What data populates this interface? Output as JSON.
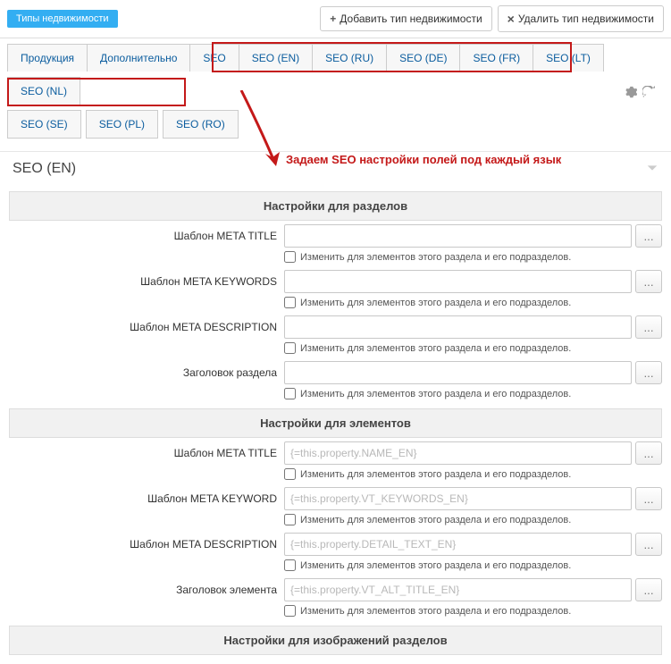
{
  "topbar": {
    "tag": "Типы недвижимости",
    "add_btn": "Добавить тип недвижимости",
    "del_btn": "Удалить тип недвижимости"
  },
  "tabs_row1": [
    "Продукция",
    "Дополнительно",
    "SEO",
    "SEO (EN)",
    "SEO (RU)",
    "SEO (DE)",
    "SEO (FR)",
    "SEO (LT)",
    "SEO (NL)"
  ],
  "tabs_row2": [
    "SEO (SE)",
    "SEO (PL)",
    "SEO (RO)"
  ],
  "section_title": "SEO (EN)",
  "annotation": "Задаем SEO настройки полей под каждый язык",
  "group1_title": "Настройки для разделов",
  "group1_fields": [
    {
      "label": "Шаблон META TITLE",
      "placeholder": "",
      "checkbox": "Изменить для элементов этого раздела и его подразделов."
    },
    {
      "label": "Шаблон META KEYWORDS",
      "placeholder": "",
      "checkbox": "Изменить для элементов этого раздела и его подразделов."
    },
    {
      "label": "Шаблон META DESCRIPTION",
      "placeholder": "",
      "checkbox": "Изменить для элементов этого раздела и его подразделов."
    },
    {
      "label": "Заголовок раздела",
      "placeholder": "",
      "checkbox": "Изменить для элементов этого раздела и его подразделов."
    }
  ],
  "group2_title": "Настройки для элементов",
  "group2_fields": [
    {
      "label": "Шаблон META TITLE",
      "placeholder": "{=this.property.NAME_EN}",
      "checkbox": "Изменить для элементов этого раздела и его подразделов."
    },
    {
      "label": "Шаблон META KEYWORD",
      "placeholder": "{=this.property.VT_KEYWORDS_EN}",
      "checkbox": "Изменить для элементов этого раздела и его подразделов."
    },
    {
      "label": "Шаблон META DESCRIPTION",
      "placeholder": "{=this.property.DETAIL_TEXT_EN}",
      "checkbox": "Изменить для элементов этого раздела и его подразделов."
    },
    {
      "label": "Заголовок элемента",
      "placeholder": "{=this.property.VT_ALT_TITLE_EN}",
      "checkbox": "Изменить для элементов этого раздела и его подразделов."
    }
  ],
  "group3_title": "Настройки для изображений разделов",
  "more_btn": "..."
}
